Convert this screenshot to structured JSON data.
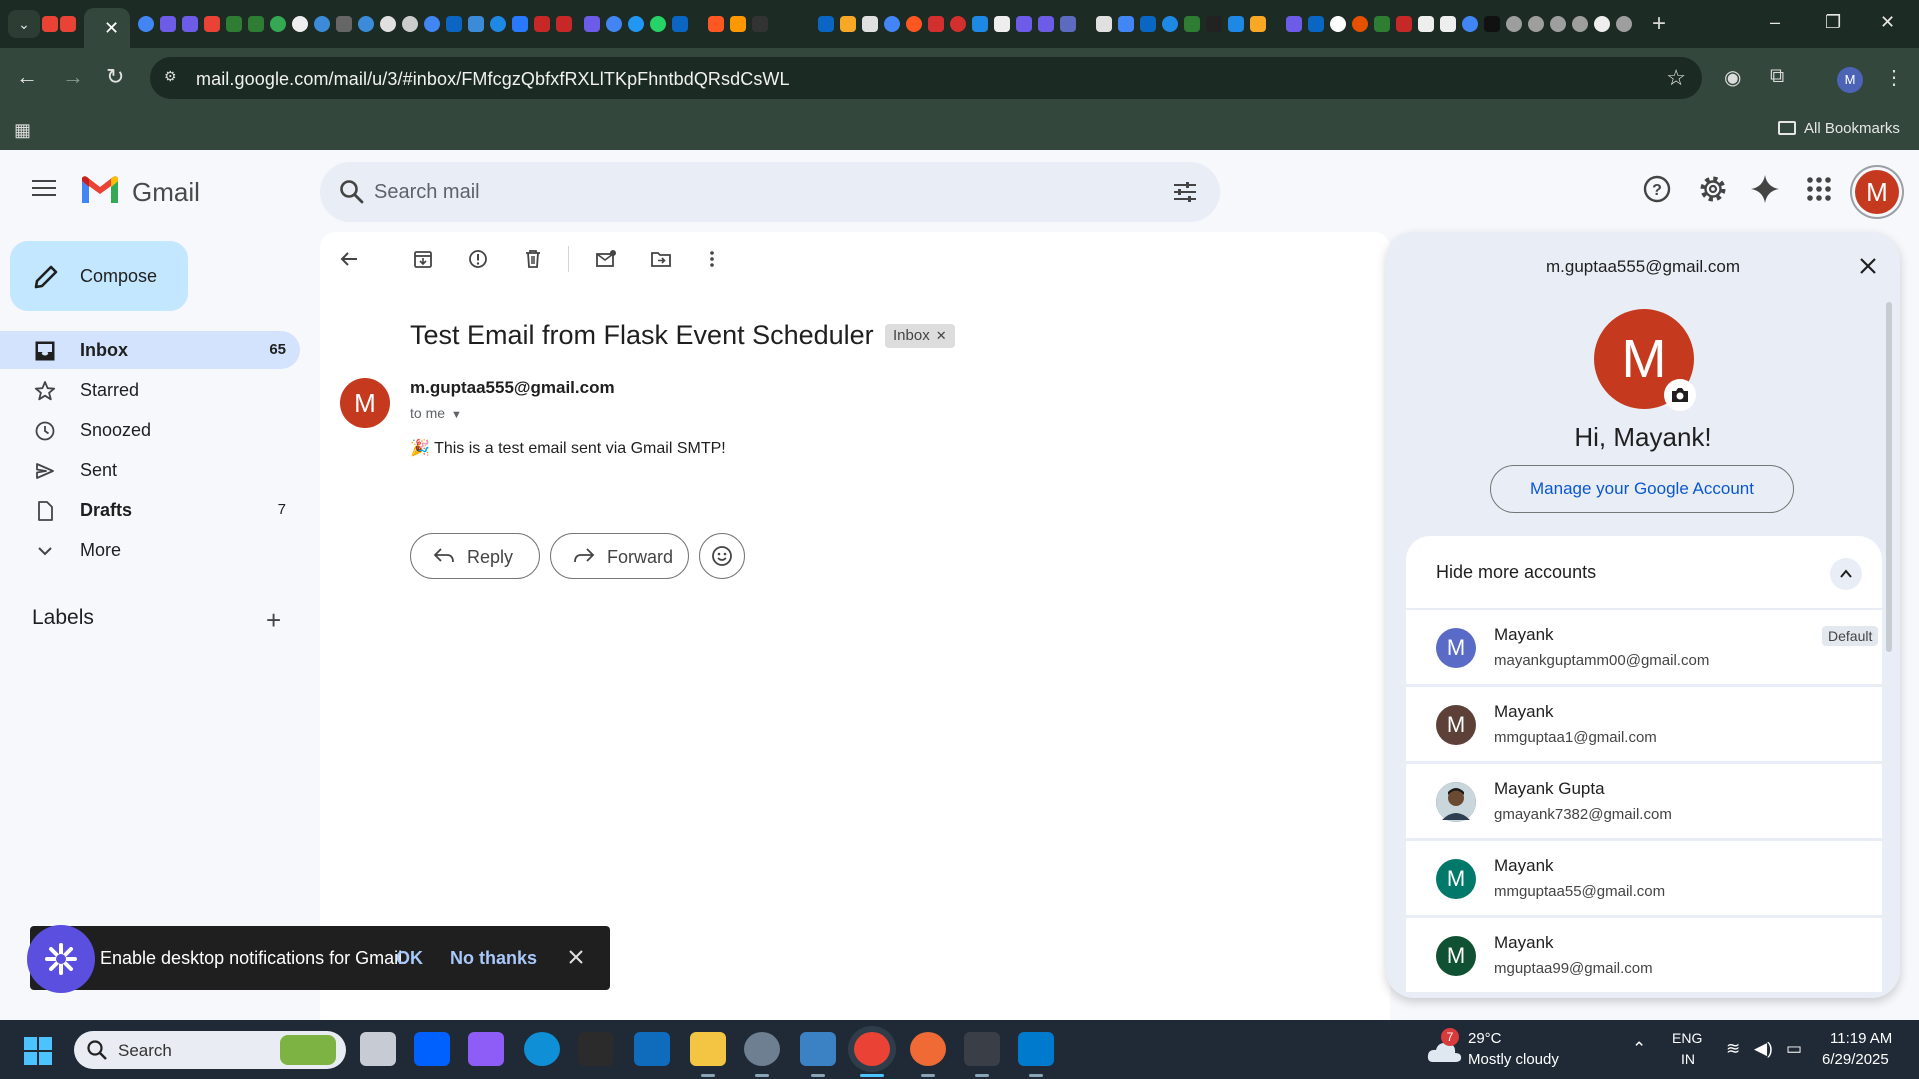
{
  "browser": {
    "active_tab_close": "✕",
    "new_tab": "+",
    "url": "mail.google.com/mail/u/3/#inbox/FMfcgzQbfxfRXLlTKpFhntbdQRsdCsWL",
    "profile_initial": "M",
    "all_bookmarks": "All Bookmarks"
  },
  "gmail": {
    "brand": "Gmail",
    "search": {
      "placeholder": "Search mail"
    },
    "account_initial": "M",
    "compose_label": "Compose",
    "nav": [
      {
        "label": "Inbox",
        "count": "65"
      },
      {
        "label": "Starred",
        "count": ""
      },
      {
        "label": "Snoozed",
        "count": ""
      },
      {
        "label": "Sent",
        "count": ""
      },
      {
        "label": "Drafts",
        "count": "7"
      },
      {
        "label": "More",
        "count": ""
      }
    ],
    "labels_title": "Labels",
    "email": {
      "subject": "Test Email from Flask Event Scheduler",
      "label_chip": "Inbox",
      "sender_initial": "M",
      "sender": "m.guptaa555@gmail.com",
      "to": "to me",
      "body": "🎉 This is a test email sent via Gmail SMTP!",
      "reply_label": "Reply",
      "forward_label": "Forward"
    }
  },
  "account_popup": {
    "email": "m.guptaa555@gmail.com",
    "avatar_initial": "M",
    "greeting": "Hi, Mayank!",
    "manage_label": "Manage your Google Account",
    "more_accounts_label": "Hide more accounts",
    "default_badge": "Default",
    "accounts": [
      {
        "name": "Mayank",
        "email": "mayankguptamm00@gmail.com",
        "initial": "M",
        "color": "#5a6bc7"
      },
      {
        "name": "Mayank",
        "email": "mmguptaa1@gmail.com",
        "initial": "M",
        "color": "#5d4037"
      },
      {
        "name": "Mayank Gupta",
        "email": "gmayank7382@gmail.com",
        "initial": "",
        "color": "#3b4a4f"
      },
      {
        "name": "Mayank",
        "email": "mmguptaa55@gmail.com",
        "initial": "M",
        "color": "#00796b"
      },
      {
        "name": "Mayank",
        "email": "mguptaa99@gmail.com",
        "initial": "M",
        "color": "#0f5132"
      }
    ]
  },
  "snackbar": {
    "text": "Enable desktop notifications for Gmail.",
    "ok_label": "OK",
    "no_label": "No thanks"
  },
  "taskbar": {
    "search_label": "Search",
    "weather_badge": "7",
    "temperature": "29°C",
    "weather": "Mostly cloudy",
    "lang_line1": "ENG",
    "lang_line2": "IN",
    "time": "11:19 AM",
    "date": "6/29/2025"
  },
  "colors": {
    "gmail_red": "#c5391e",
    "compose_blue": "#c2e7ff",
    "active_nav": "#d3e3fd",
    "link_blue": "#0b57d0",
    "chrome_frame": "#33473c"
  }
}
